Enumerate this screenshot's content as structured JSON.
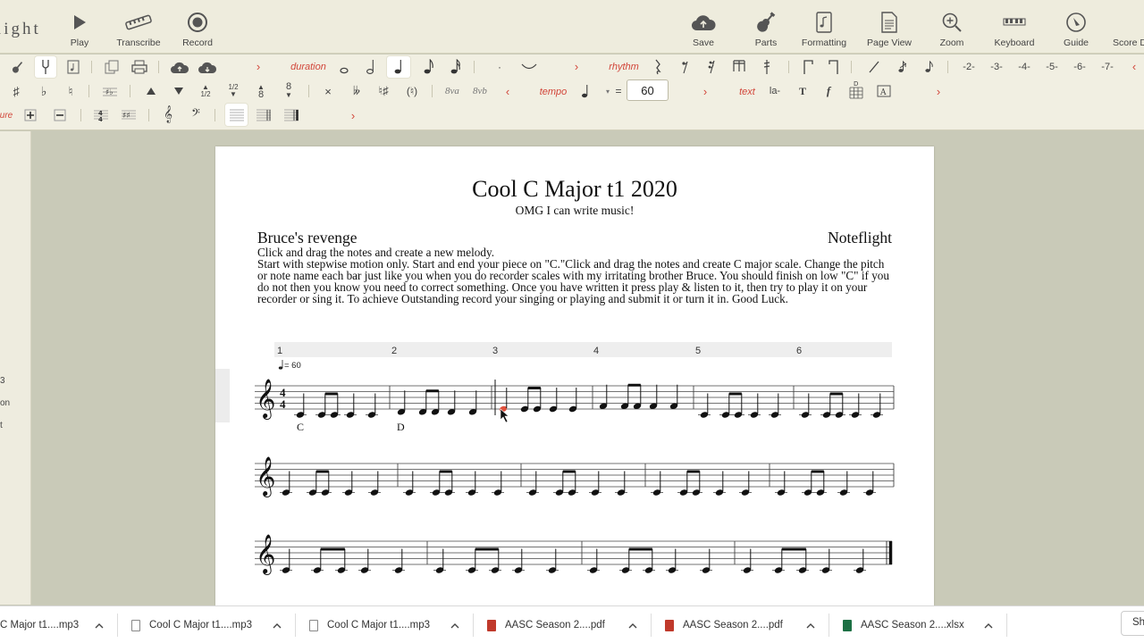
{
  "app": {
    "logo": "light"
  },
  "toolbar": {
    "left": [
      {
        "label": "Play",
        "icon": "play-icon"
      },
      {
        "label": "Transcribe",
        "icon": "transcribe-icon"
      },
      {
        "label": "Record",
        "icon": "record-icon"
      }
    ],
    "right": [
      {
        "label": "Save",
        "icon": "cloud-save-icon"
      },
      {
        "label": "Parts",
        "icon": "guitar-icon"
      },
      {
        "label": "Formatting",
        "icon": "formatting-icon"
      },
      {
        "label": "Page View",
        "icon": "page-view-icon"
      },
      {
        "label": "Zoom",
        "icon": "zoom-icon"
      },
      {
        "label": "Keyboard",
        "icon": "keyboard-icon"
      },
      {
        "label": "Guide",
        "icon": "guide-icon"
      },
      {
        "label": "Score D",
        "icon": "score-details-icon"
      }
    ]
  },
  "palette": {
    "duration_label": "duration",
    "rhythm_label": "rhythm",
    "tempo_label": "tempo",
    "tempo_eq": "=",
    "tempo_value": "60",
    "text_label": "text",
    "lyric_btn": "la-",
    "text_btn": "T",
    "dynamic_btn": "f",
    "frac_half": "1/2",
    "octave_up": "8va",
    "octave_down": "8vb",
    "tuplets": [
      "2",
      "3",
      "4",
      "5",
      "6",
      "7"
    ],
    "measure_label": "ure"
  },
  "sidebar": {
    "items": [
      "3",
      "on",
      "t"
    ]
  },
  "score": {
    "title": "Cool C Major t1 2020",
    "subtitle": "OMG I can write music!",
    "composer": "Bruce's revenge",
    "credit": "Noteflight",
    "instructions": "Click and drag the notes and create a new melody.\nStart with stepwise motion only. Start and end your piece on \"C.\"Click and drag the notes and create C major scale. Change the pitch or note name each bar just like you when you do recorder scales with my irritating brother Bruce. You should finish on low \"C\" if you do not then you know you need to correct something. Once you have written it press play & listen to it, then try to play it on your recorder or sing it. To achieve Outstanding record your singing or playing and submit it or turn it in. Good Luck.",
    "tempo_mark": "= 60",
    "time_signature": [
      "4",
      "4"
    ],
    "measure_numbers": [
      "1",
      "2",
      "3",
      "4",
      "5",
      "6"
    ],
    "lyrics": [
      "C",
      "D"
    ]
  },
  "downloads": {
    "items": [
      {
        "name": "C Major t1....mp3",
        "type": "audio"
      },
      {
        "name": "Cool C Major t1....mp3",
        "type": "audio"
      },
      {
        "name": "Cool C Major t1....mp3",
        "type": "audio"
      },
      {
        "name": "AASC Season 2....pdf",
        "type": "pdf"
      },
      {
        "name": "AASC Season 2....pdf",
        "type": "pdf"
      },
      {
        "name": "AASC Season 2....xlsx",
        "type": "xlsx"
      }
    ],
    "show_all": "Sh"
  },
  "colors": {
    "accent": "#d2463a",
    "toolbar_bg": "#eeecdd",
    "canvas_bg": "#c9cab8",
    "excel_green": "#1d7044",
    "pdf_red": "#c0392b"
  }
}
